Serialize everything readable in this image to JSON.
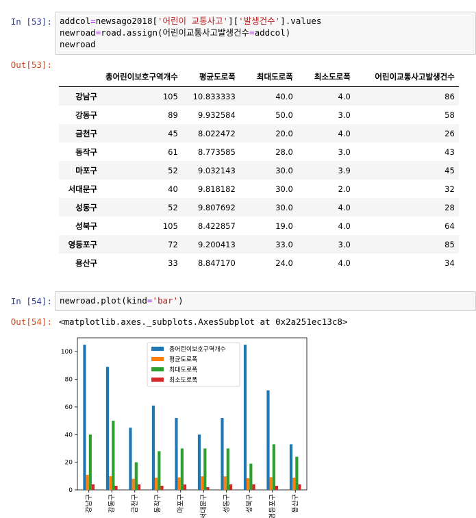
{
  "cell53": {
    "in_prompt": "In [53]:",
    "code": [
      [
        {
          "t": "addcol"
        },
        {
          "t": "=",
          "c": "tok-op"
        },
        {
          "t": "newsago2018["
        },
        {
          "t": "'어린이 교통사고'",
          "c": "tok-str"
        },
        {
          "t": "]["
        },
        {
          "t": "'발생건수'",
          "c": "tok-str"
        },
        {
          "t": "].values"
        }
      ],
      [
        {
          "t": "newroad"
        },
        {
          "t": "=",
          "c": "tok-op"
        },
        {
          "t": "road.assign(어린이교통사고발생건수"
        },
        {
          "t": "=",
          "c": "tok-op"
        },
        {
          "t": "addcol)"
        }
      ],
      [
        {
          "t": "newroad"
        }
      ]
    ],
    "out_prompt": "Out[53]:",
    "table": {
      "columns": [
        "",
        "총어린이보호구역개수",
        "평균도로폭",
        "최대도로폭",
        "최소도로폭",
        "어린이교통사고발생건수"
      ],
      "rows": [
        [
          "강남구",
          "105",
          "10.833333",
          "40.0",
          "4.0",
          "86"
        ],
        [
          "강동구",
          "89",
          "9.932584",
          "50.0",
          "3.0",
          "58"
        ],
        [
          "금천구",
          "45",
          "8.022472",
          "20.0",
          "4.0",
          "26"
        ],
        [
          "동작구",
          "61",
          "8.773585",
          "28.0",
          "3.0",
          "43"
        ],
        [
          "마포구",
          "52",
          "9.032143",
          "30.0",
          "3.9",
          "45"
        ],
        [
          "서대문구",
          "40",
          "9.818182",
          "30.0",
          "2.0",
          "32"
        ],
        [
          "성동구",
          "52",
          "9.807692",
          "30.0",
          "4.0",
          "28"
        ],
        [
          "성북구",
          "105",
          "8.422857",
          "19.0",
          "4.0",
          "64"
        ],
        [
          "영등포구",
          "72",
          "9.200413",
          "33.0",
          "3.0",
          "85"
        ],
        [
          "용산구",
          "33",
          "8.847170",
          "24.0",
          "4.0",
          "34"
        ]
      ]
    }
  },
  "cell54": {
    "in_prompt": "In [54]:",
    "code": [
      [
        {
          "t": "newroad.plot(kind"
        },
        {
          "t": "=",
          "c": "tok-op"
        },
        {
          "t": "'bar'",
          "c": "tok-str"
        },
        {
          "t": ")"
        }
      ]
    ],
    "out_prompt": "Out[54]:",
    "out_text": "<matplotlib.axes._subplots.AxesSubplot at 0x2a251ec13c8>"
  },
  "chart_data": {
    "type": "bar",
    "categories": [
      "강남구",
      "강동구",
      "금천구",
      "동작구",
      "마포구",
      "서대문구",
      "성동구",
      "성북구",
      "영등포구",
      "용산구"
    ],
    "series": [
      {
        "name": "총어린이보호구역개수",
        "color": "#1f77b4",
        "values": [
          105,
          89,
          45,
          61,
          52,
          40,
          52,
          105,
          72,
          33
        ]
      },
      {
        "name": "평균도로폭",
        "color": "#ff7f0e",
        "values": [
          10.833333,
          9.932584,
          8.022472,
          8.773585,
          9.032143,
          9.818182,
          9.807692,
          8.422857,
          9.200413,
          8.84717
        ]
      },
      {
        "name": "최대도로폭",
        "color": "#2ca02c",
        "values": [
          40.0,
          50.0,
          20.0,
          28.0,
          30.0,
          30.0,
          30.0,
          19.0,
          33.0,
          24.0
        ]
      },
      {
        "name": "최소도로폭",
        "color": "#d62728",
        "values": [
          4.0,
          3.0,
          4.0,
          3.0,
          3.9,
          2.0,
          4.0,
          4.0,
          3.0,
          4.0
        ]
      }
    ],
    "ylim": [
      0,
      110
    ],
    "yticks": [
      0,
      20,
      40,
      60,
      80,
      100
    ],
    "legend": "top-center",
    "grid": false
  }
}
